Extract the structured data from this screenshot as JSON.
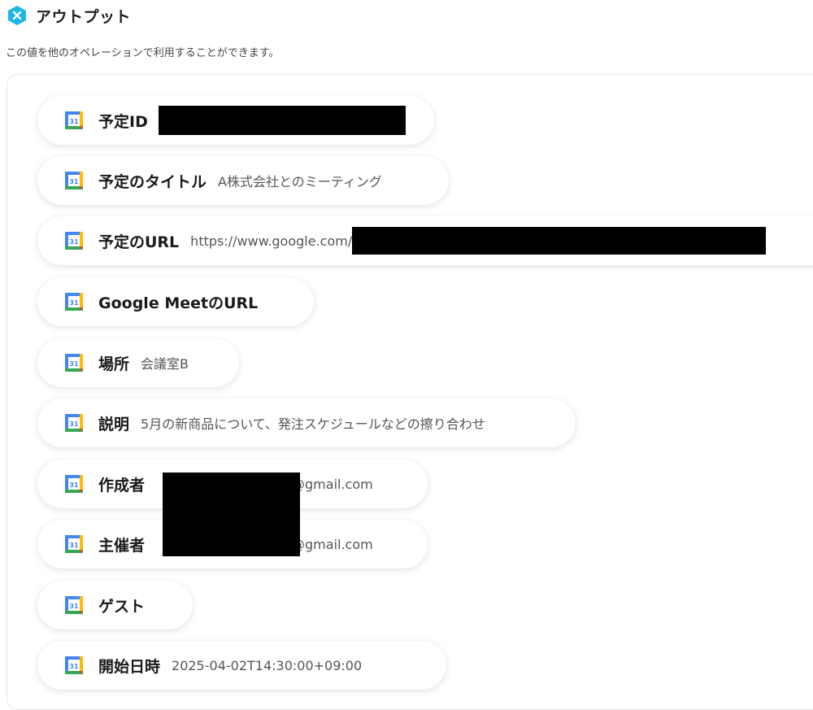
{
  "header": {
    "title": "アウトプット",
    "subtitle": "この値を他のオペレーションで利用することができます。",
    "accent": "#1fb6e6"
  },
  "calendar_icon": {
    "name": "google-calendar-icon",
    "day": "31"
  },
  "outputs": [
    {
      "label": "予定ID",
      "value": ""
    },
    {
      "label": "予定のタイトル",
      "value": "A株式会社とのミーティング"
    },
    {
      "label": "予定のURL",
      "value": "https://www.google.com/"
    },
    {
      "label": "Google MeetのURL",
      "value": ""
    },
    {
      "label": "場所",
      "value": "会議室B"
    },
    {
      "label": "説明",
      "value": "5月の新商品について、発注スケジュールなどの擦り合わせ"
    },
    {
      "label": "作成者",
      "value": "@gmail.com"
    },
    {
      "label": "主催者",
      "value": "@gmail.com"
    },
    {
      "label": "ゲスト",
      "value": ""
    },
    {
      "label": "開始日時",
      "value": "2025-04-02T14:30:00+09:00"
    }
  ]
}
